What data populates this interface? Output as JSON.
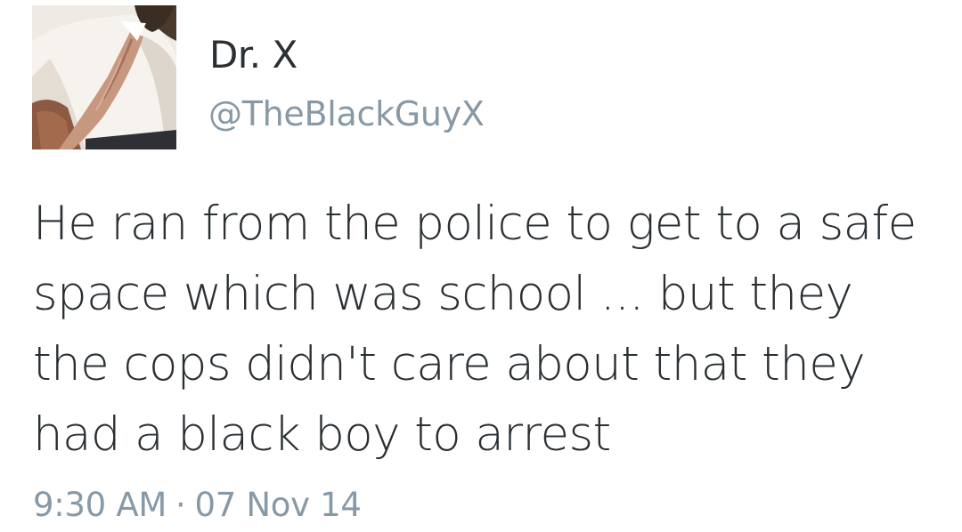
{
  "user": {
    "display_name": "Dr. X",
    "handle": "@TheBlackGuyX",
    "avatar_icon": "profile-photo"
  },
  "tweet": {
    "lines": [
      "He ran from the police to get to a safe",
      "space which was school ... but they",
      "the cops didn't care about that they",
      "had a black boy to arrest"
    ],
    "time": "9:30 AM",
    "separator": "·",
    "date": "07 Nov 14"
  },
  "colors": {
    "text": "#292f33",
    "secondary": "#8899a6",
    "background": "#ffffff"
  }
}
